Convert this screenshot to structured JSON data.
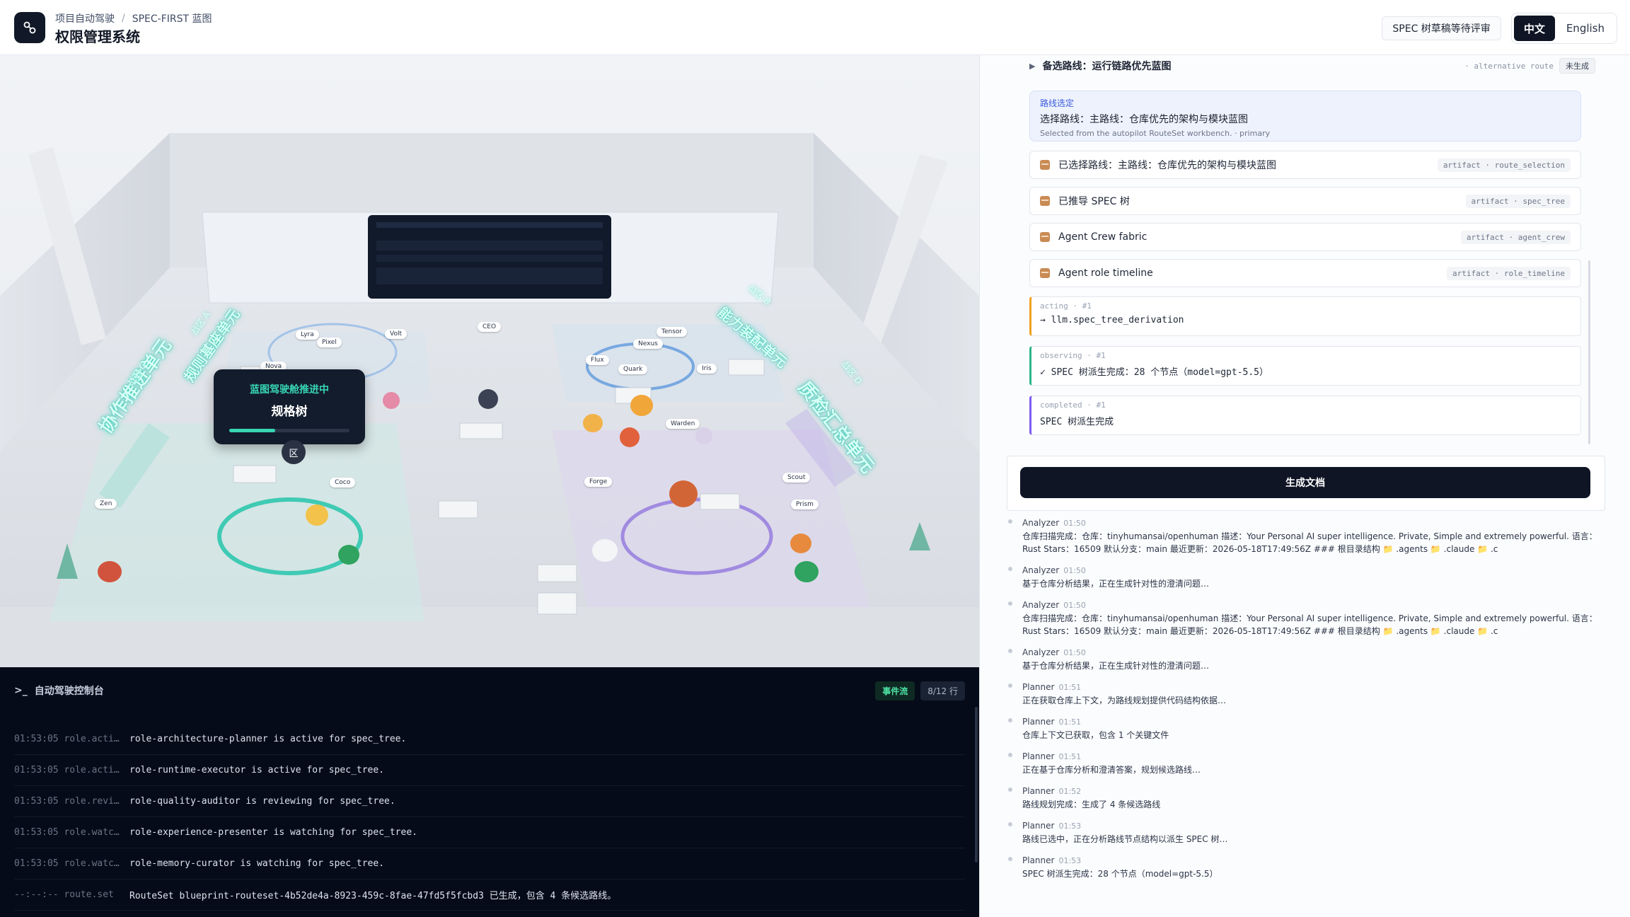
{
  "header": {
    "breadcrumb": [
      "项目自动驾驶",
      "SPEC-FIRST 蓝图"
    ],
    "breadcrumb_sep": "/",
    "title": "权限管理系统",
    "status_pill": "SPEC 树草稿等待评审",
    "lang": {
      "zh": "中文",
      "en": "English",
      "active": "zh"
    }
  },
  "scene": {
    "float_card": {
      "kicker": "蓝图驾驶舱推进中",
      "title": "规格树",
      "progress": 0.38
    },
    "zones": [
      {
        "label": "协作推进单元",
        "sub": "战区 C"
      },
      {
        "label": "规则基座单元",
        "sub": "战区 A"
      },
      {
        "label": "能力装配单元",
        "sub": "战区 B"
      },
      {
        "label": "质检汇总单元",
        "sub": "战区 D"
      }
    ],
    "agents": [
      "Lyra",
      "Pixel",
      "Nova",
      "Volt",
      "CEO",
      "Tensor",
      "Nexus",
      "Flux",
      "Quark",
      "Iris",
      "Warden",
      "Forge",
      "Scout",
      "Prism",
      "Coco",
      "Zen"
    ],
    "zone_marker": "区"
  },
  "console": {
    "title": "自动驾驶控制台",
    "prompt": ">_",
    "badge_stream": "事件流",
    "badge_count": "8/12 行",
    "rows": [
      {
        "meta": "01:53:05 role.acti…",
        "msg": "role-architecture-planner is active for spec_tree."
      },
      {
        "meta": "01:53:05 role.acti…",
        "msg": "role-runtime-executor is active for spec_tree."
      },
      {
        "meta": "01:53:05 role.revi…",
        "msg": "role-quality-auditor is reviewing for spec_tree."
      },
      {
        "meta": "01:53:05 role.watc…",
        "msg": "role-experience-presenter is watching for spec_tree."
      },
      {
        "meta": "01:53:05 role.watc…",
        "msg": "role-memory-curator is watching for spec_tree."
      },
      {
        "meta": "--:--:-- route.set",
        "msg": "RouteSet blueprint-routeset-4b52de4a-8923-459c-8fae-47fd5f5fcbd3 已生成，包含 4 条候选路线。"
      }
    ]
  },
  "side": {
    "alt_route": {
      "label": "备选路线：运行链路优先蓝图",
      "tag": "· alternative route",
      "status": "未生成"
    },
    "route_selection": {
      "kicker": "路线选定",
      "title": "选择路线：主路线：仓库优先的架构与模块蓝图",
      "sub": "Selected from the autopilot RouteSet workbench. · primary"
    },
    "artifacts": [
      {
        "label": "已选择路线：主路线：仓库优先的架构与模块蓝图",
        "tag": "artifact · route_selection"
      },
      {
        "label": "已推导 SPEC 树",
        "tag": "artifact · spec_tree"
      },
      {
        "label": "Agent Crew fabric",
        "tag": "artifact · agent_crew"
      },
      {
        "label": "Agent role timeline",
        "tag": "artifact · role_timeline"
      }
    ],
    "phases": [
      {
        "kicker": "acting · #1",
        "value": "→ llm.spec_tree_derivation",
        "color": "#f0a020"
      },
      {
        "kicker": "observing · #1",
        "value": "✓ SPEC 树派生完成：28 个节点（model=gpt-5.5）",
        "color": "#2fb48a"
      },
      {
        "kicker": "completed · #1",
        "value": "SPEC 树派生完成",
        "color": "#7b5cf0"
      }
    ],
    "generate_button": "生成文档",
    "events": [
      {
        "who": "Analyzer",
        "time": "01:50",
        "text": "仓库扫描完成：仓库：tinyhumansai/openhuman 描述：Your Personal AI super intelligence. Private, Simple and extremely powerful. 语言：Rust Stars：16509 默认分支：main 最近更新：2026-05-18T17:49:56Z ### 根目录结构 📁 .agents 📁 .claude 📁 .c"
      },
      {
        "who": "Analyzer",
        "time": "01:50",
        "text": "基于仓库分析结果，正在生成针对性的澄清问题…"
      },
      {
        "who": "Analyzer",
        "time": "01:50",
        "text": "仓库扫描完成：仓库：tinyhumansai/openhuman 描述：Your Personal AI super intelligence. Private, Simple and extremely powerful. 语言：Rust Stars：16509 默认分支：main 最近更新：2026-05-18T17:49:56Z ### 根目录结构 📁 .agents 📁 .claude 📁 .c"
      },
      {
        "who": "Analyzer",
        "time": "01:50",
        "text": "基于仓库分析结果，正在生成针对性的澄清问题…"
      },
      {
        "who": "Planner",
        "time": "01:51",
        "text": "正在获取仓库上下文，为路线规划提供代码结构依据…"
      },
      {
        "who": "Planner",
        "time": "01:51",
        "text": "仓库上下文已获取，包含 1 个关键文件"
      },
      {
        "who": "Planner",
        "time": "01:51",
        "text": "正在基于仓库分析和澄清答案，规划候选路线…"
      },
      {
        "who": "Planner",
        "time": "01:52",
        "text": "路线规划完成：生成了 4 条候选路线"
      },
      {
        "who": "Planner",
        "time": "01:53",
        "text": "路线已选中，正在分析路线节点结构以派生 SPEC 树…"
      },
      {
        "who": "Planner",
        "time": "01:53",
        "text": "SPEC 树派生完成：28 个节点（model=gpt-5.5）"
      }
    ]
  }
}
